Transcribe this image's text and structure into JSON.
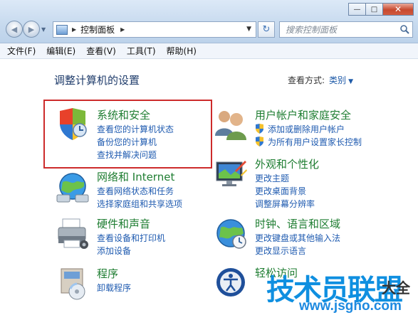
{
  "window": {
    "minimize_glyph": "—",
    "maximize_glyph": "□",
    "close_glyph": "✕"
  },
  "nav": {
    "back_glyph": "◀",
    "forward_glyph": "▶",
    "dropdown_glyph": "▼"
  },
  "address": {
    "crumb": "控制面板",
    "sep_glyph": "▶",
    "dropdown_glyph": "▼",
    "refresh_glyph": "↻"
  },
  "search": {
    "placeholder": "搜索控制面板"
  },
  "menu": {
    "file": "文件(F)",
    "edit": "编辑(E)",
    "view": "查看(V)",
    "tools": "工具(T)",
    "help": "帮助(H)"
  },
  "main": {
    "title": "调整计算机的设置",
    "view_by_label": "查看方式:",
    "view_by_value": "类别",
    "view_by_caret": "▼"
  },
  "categories": {
    "system": {
      "title": "系统和安全",
      "links": [
        "查看您的计算机状态",
        "备份您的计算机",
        "查找并解决问题"
      ]
    },
    "network": {
      "title": "网络和 Internet",
      "links": [
        "查看网络状态和任务",
        "选择家庭组和共享选项"
      ]
    },
    "hardware": {
      "title": "硬件和声音",
      "links": [
        "查看设备和打印机",
        "添加设备"
      ]
    },
    "programs": {
      "title": "程序",
      "links": [
        "卸载程序"
      ]
    },
    "users": {
      "title": "用户帐户和家庭安全",
      "links": [
        "添加或删除用户帐户",
        "为所有用户设置家长控制"
      ]
    },
    "appearance": {
      "title": "外观和个性化",
      "links": [
        "更改主题",
        "更改桌面背景",
        "调整屏幕分辨率"
      ]
    },
    "clock": {
      "title": "时钟、语言和区域",
      "links": [
        "更改键盘或其他输入法",
        "更改显示语言"
      ]
    },
    "access": {
      "title": "轻松访问"
    }
  },
  "watermark": {
    "text": "技术员联盟",
    "url": "www.jsgho.com",
    "suffix": "大全"
  },
  "colors": {
    "category_title": "#1e7d31",
    "link": "#1f5bb0",
    "highlight_border": "#cd2b2b",
    "chrome": "#c6d9ee"
  }
}
